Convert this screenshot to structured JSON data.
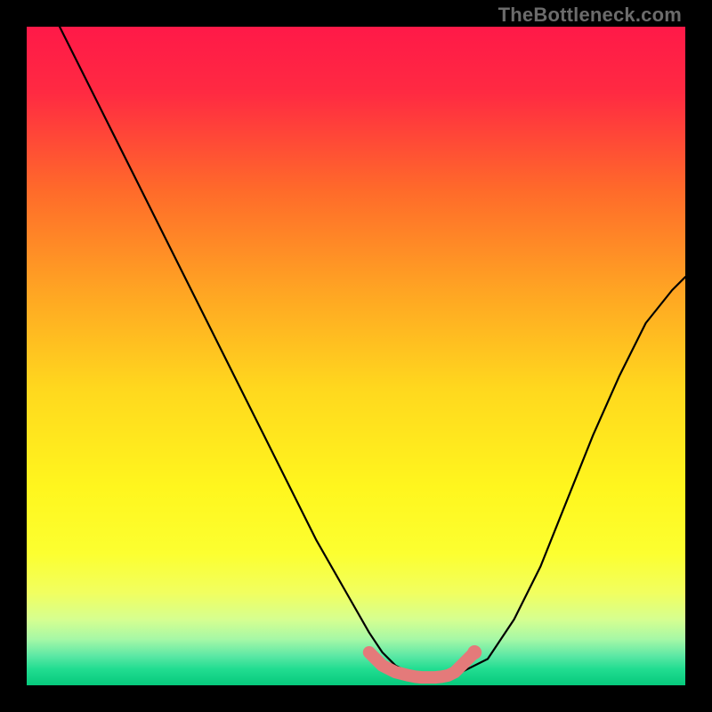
{
  "watermark": "TheBottleneck.com",
  "chart_data": {
    "type": "line",
    "title": "",
    "xlabel": "",
    "ylabel": "",
    "xlim": [
      0,
      100
    ],
    "ylim": [
      0,
      100
    ],
    "grid": false,
    "series": [
      {
        "name": "bottleneck-curve",
        "x": [
          0,
          4,
          8,
          12,
          16,
          20,
          24,
          28,
          32,
          36,
          40,
          44,
          48,
          52,
          54,
          56,
          58,
          60,
          62,
          64,
          66,
          70,
          74,
          78,
          82,
          86,
          90,
          94,
          98,
          100
        ],
        "y": [
          110,
          102,
          94,
          86,
          78,
          70,
          62,
          54,
          46,
          38,
          30,
          22,
          15,
          8,
          5,
          3,
          2,
          1,
          1,
          1,
          2,
          4,
          10,
          18,
          28,
          38,
          47,
          55,
          60,
          62
        ]
      }
    ],
    "highlight": {
      "name": "optimal-zone-marker",
      "x": [
        52,
        54,
        56,
        58,
        59,
        60,
        61,
        62,
        63,
        64,
        65,
        66,
        68
      ],
      "y": [
        5,
        3,
        2,
        1.5,
        1.3,
        1.2,
        1.2,
        1.2,
        1.3,
        1.5,
        2,
        3,
        5
      ],
      "color": "#e47a7a"
    },
    "gradient_stops": [
      {
        "offset": 0.0,
        "color": "#ff1948"
      },
      {
        "offset": 0.1,
        "color": "#ff2a42"
      },
      {
        "offset": 0.25,
        "color": "#ff6b2a"
      },
      {
        "offset": 0.4,
        "color": "#ffa423"
      },
      {
        "offset": 0.55,
        "color": "#ffd81e"
      },
      {
        "offset": 0.7,
        "color": "#fff61e"
      },
      {
        "offset": 0.8,
        "color": "#fcff30"
      },
      {
        "offset": 0.86,
        "color": "#f1ff60"
      },
      {
        "offset": 0.9,
        "color": "#d6ff90"
      },
      {
        "offset": 0.93,
        "color": "#a6f8a6"
      },
      {
        "offset": 0.955,
        "color": "#5de8a5"
      },
      {
        "offset": 0.975,
        "color": "#22dd91"
      },
      {
        "offset": 1.0,
        "color": "#06c97c"
      }
    ]
  }
}
